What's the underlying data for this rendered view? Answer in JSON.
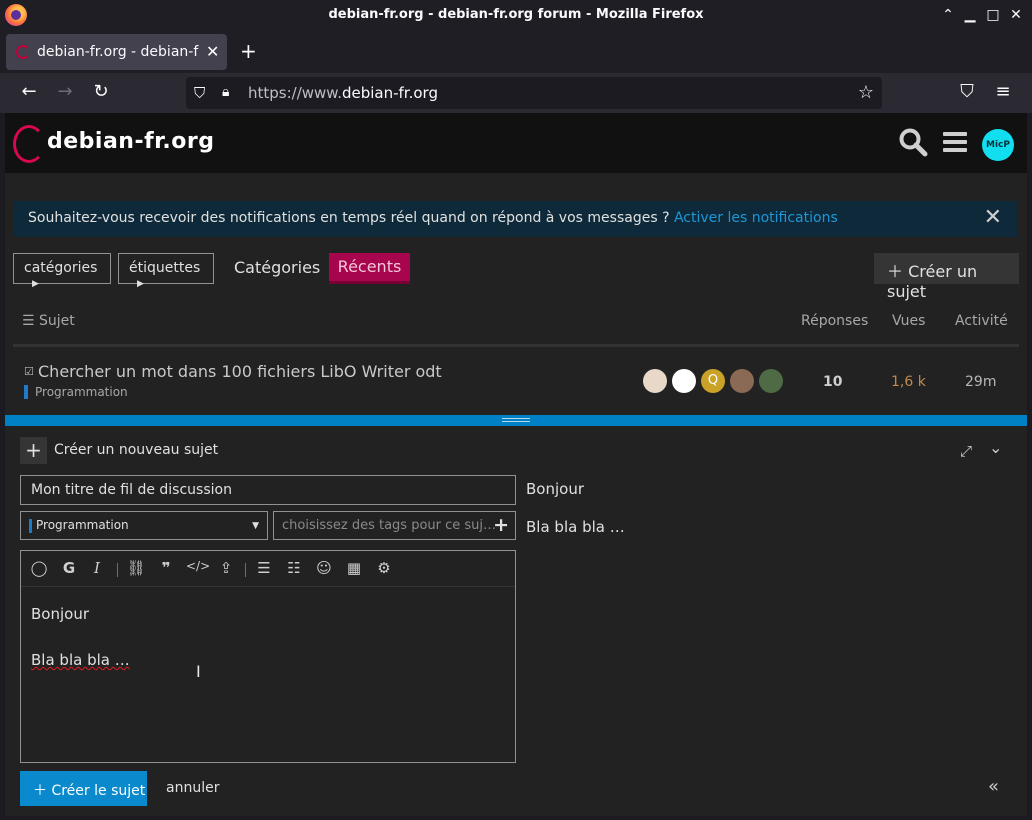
{
  "window": {
    "title": "debian-fr.org - debian-fr.org forum - Mozilla Firefox"
  },
  "browser": {
    "tab_label": "debian-fr.org - debian-fr.org forum",
    "url_prefix": "https://www.",
    "url_domain": "debian-fr.org"
  },
  "site": {
    "logo_text": "debian-fr.org",
    "avatar_initials": "MicP"
  },
  "notification": {
    "text": "Souhaitez-vous recevoir des notifications en temps réel quand on répond à vos messages ?",
    "link": "Activer les notifications"
  },
  "nav": {
    "categories_dropdown": "catégories",
    "tags_dropdown": "étiquettes",
    "categories_link": "Catégories",
    "recents_link": "Récents",
    "create_topic": "Créer un sujet"
  },
  "table": {
    "headers": {
      "subject": "Sujet",
      "replies": "Réponses",
      "views": "Vues",
      "activity": "Activité"
    },
    "rows": [
      {
        "title": "Chercher un mot dans 100 fichiers LibO Writer odt",
        "category": "Programmation",
        "replies": "10",
        "views": "1,6 k",
        "activity": "29m",
        "poster_q": "Q"
      }
    ]
  },
  "composer": {
    "header": "Créer un nouveau sujet",
    "title_value": "Mon titre de fil de discussion",
    "category_value": "Programmation",
    "tags_placeholder": "choisissez des tags pour ce suj…",
    "body_line1": "Bonjour",
    "body_line2": "Bla bla bla …",
    "preview_line1": "Bonjour",
    "preview_line2": "Bla bla bla …",
    "submit_label": "Créer le sujet",
    "cancel_label": "annuler"
  },
  "colors": {
    "accent": "#0a89cd",
    "recents": "#a7064e",
    "category": "#1e7bc8"
  }
}
